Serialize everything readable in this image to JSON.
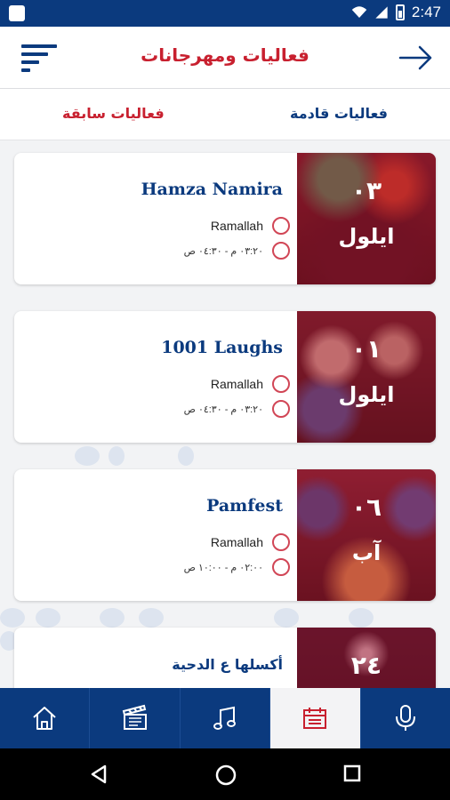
{
  "status_bar": {
    "time": "2:47"
  },
  "header": {
    "title": "فعاليات ومهرجانات"
  },
  "tabs": {
    "past_label": "فعاليات سابقة",
    "upcoming_label": "فعاليات قادمة"
  },
  "events": [
    {
      "title": "Hamza Namira",
      "day": "٠٣",
      "month": "ايلول",
      "location": "Ramallah",
      "time": "٠٣:٢٠ م - ٠٤:٣٠ ص"
    },
    {
      "title": "1001 Laughs",
      "day": "٠١",
      "month": "ايلول",
      "location": "Ramallah",
      "time": "٠٣:٢٠ م - ٠٤:٣٠ ص"
    },
    {
      "title": "Pamfest",
      "day": "٠٦",
      "month": "آب",
      "location": "Ramallah",
      "time": "٠٢:٠٠ م - ١٠:٠٠ ص"
    },
    {
      "title": "أكسلها ع الدحية",
      "day": "٢٤",
      "month": ""
    }
  ],
  "bottom_nav": [
    "home-icon",
    "clapperboard-icon",
    "music-icon",
    "calendar-icon",
    "microphone-icon"
  ],
  "colors": {
    "brand_blue": "#0b3a7e",
    "accent_red": "#c8202f"
  }
}
